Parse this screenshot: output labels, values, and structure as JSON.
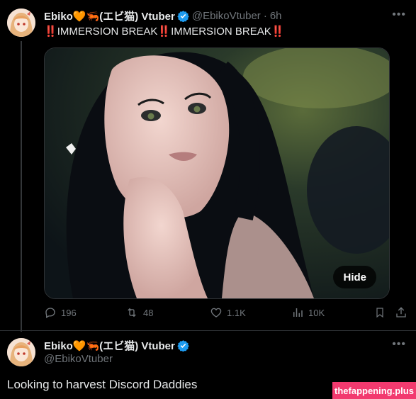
{
  "tweet1": {
    "display_name": "Ebiko🧡🦐(エビ猫) Vtuber",
    "handle": "@EbikoVtuber",
    "separator": "·",
    "time": "6h",
    "more_icon": "more-icon",
    "text_parts": [
      "‼️",
      "IMMERSION BREAK",
      "‼️",
      "IMMERSION BREAK",
      "‼️"
    ],
    "media": {
      "hide_label": "Hide"
    },
    "actions": {
      "replies": "196",
      "retweets": "48",
      "likes": "1.1K",
      "views": "10K"
    }
  },
  "tweet2": {
    "display_name": "Ebiko🧡🦐(エビ猫) Vtuber",
    "handle": "@EbikoVtuber",
    "text": "Looking to harvest Discord Daddies"
  },
  "watermark": "thefappening.plus",
  "colors": {
    "background": "#000000",
    "text": "#e7e9ea",
    "muted": "#71767b",
    "verified": "#1d9bf0",
    "watermark_bg": "#f23a6f"
  }
}
